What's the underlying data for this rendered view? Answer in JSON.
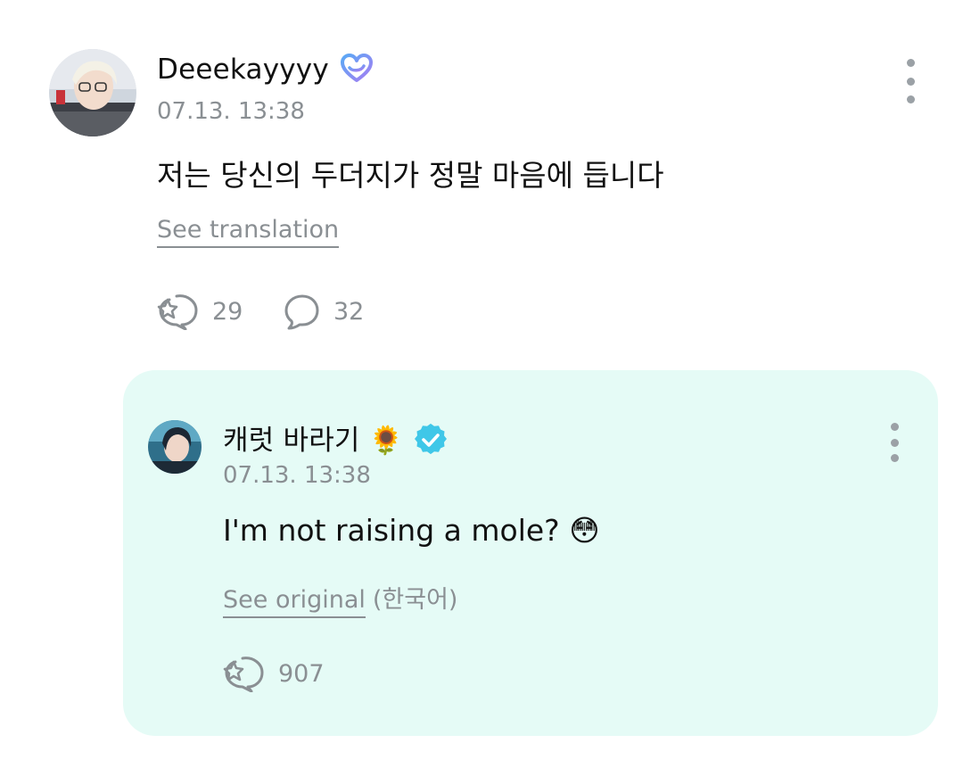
{
  "post": {
    "author": {
      "name": "Deeekayyyy",
      "badge_icon": "heart-membership-icon"
    },
    "timestamp": "07.13. 13:38",
    "text": "저는 당신의 두더지가 정말 마음에 듭니다",
    "translate_link": "See translation",
    "stats": {
      "reactions": "29",
      "comments": "32"
    },
    "menu_icon": "more-vertical-icon"
  },
  "reply": {
    "author": {
      "name": "캐럿 바라기",
      "emoji": "🌻",
      "badge_icon": "verified-check-icon"
    },
    "timestamp": "07.13. 13:38",
    "text": "I'm not raising a mole?",
    "text_emoji": "😳",
    "original_link": "See original",
    "original_lang": "(한국어)",
    "stats": {
      "reactions": "907"
    },
    "menu_icon": "more-vertical-icon",
    "background_color": "#e5fbf6"
  },
  "colors": {
    "muted_text": "#8a8f93",
    "primary_text": "#111111",
    "verified_blue": "#3fc7e8",
    "badge_gradient_start": "#5aa9f5",
    "badge_gradient_end": "#a57df2"
  }
}
